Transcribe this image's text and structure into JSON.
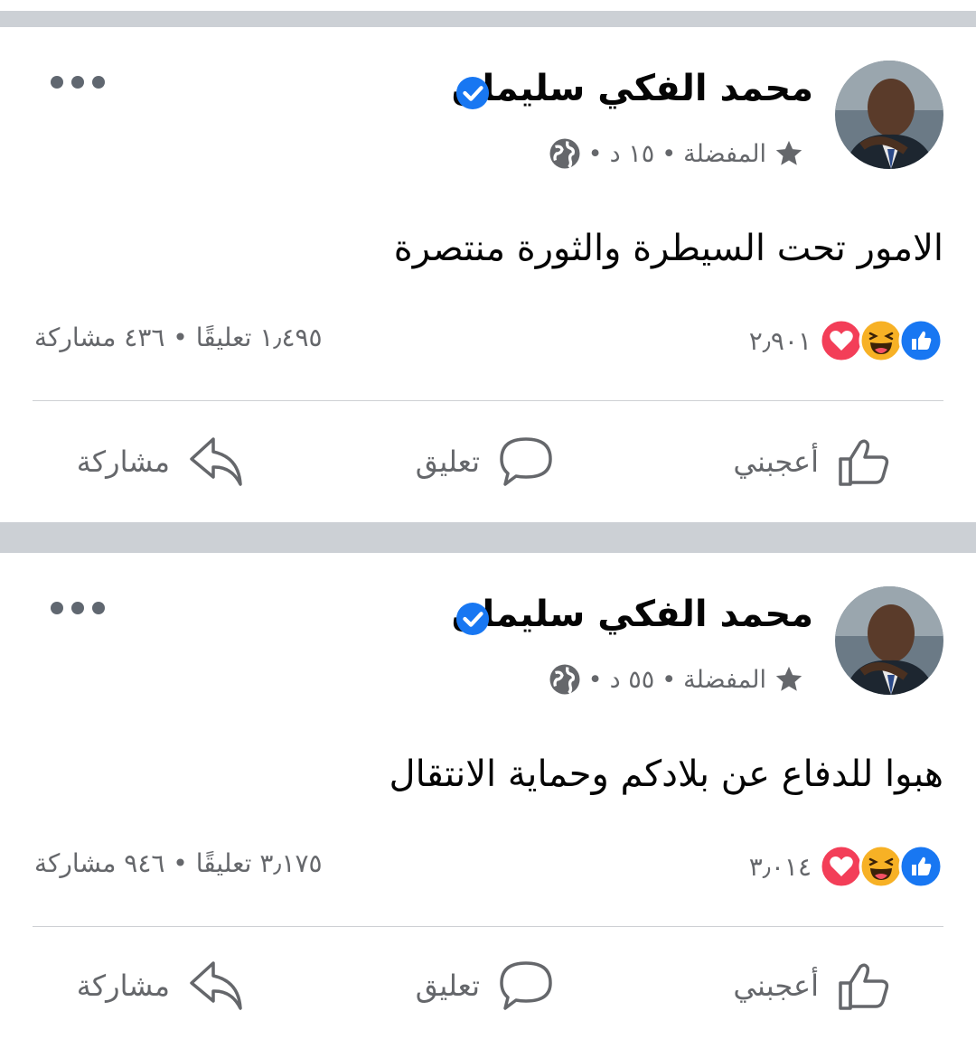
{
  "posts": [
    {
      "author": "محمد الفكي سليمان",
      "audience": "المفضلة",
      "time": "١٥ د",
      "dot": "•",
      "text": "الامور تحت السيطرة والثورة منتصرة",
      "reactions_count": "٢٫٩٠١",
      "comments_shares": "١٫٤٩٥ تعليقًا • ٤٣٦ مشاركة",
      "actions": {
        "like": "أعجبني",
        "comment": "تعليق",
        "share": "مشاركة"
      }
    },
    {
      "author": "محمد الفكي سليمان",
      "audience": "المفضلة",
      "time": "٥٥ د",
      "dot": "•",
      "text": "هبوا للدفاع عن بلادكم وحماية الانتقال",
      "reactions_count": "٣٫٠١٤",
      "comments_shares": "٣٫١٧٥ تعليقًا • ٩٤٦ مشاركة",
      "actions": {
        "like": "أعجبني",
        "comment": "تعليق",
        "share": "مشاركة"
      }
    }
  ],
  "colors": {
    "accent": "#1877f2",
    "love": "#f33e58",
    "haha": "#f7b125",
    "separator": "#ccd0d5",
    "secondary_text": "#65676b"
  },
  "icons": [
    "avatar",
    "verified-icon",
    "star-icon",
    "globe-icon",
    "more-icon",
    "like-reaction-icon",
    "haha-reaction-icon",
    "love-reaction-icon",
    "thumbs-up-icon",
    "comment-icon",
    "share-icon"
  ]
}
